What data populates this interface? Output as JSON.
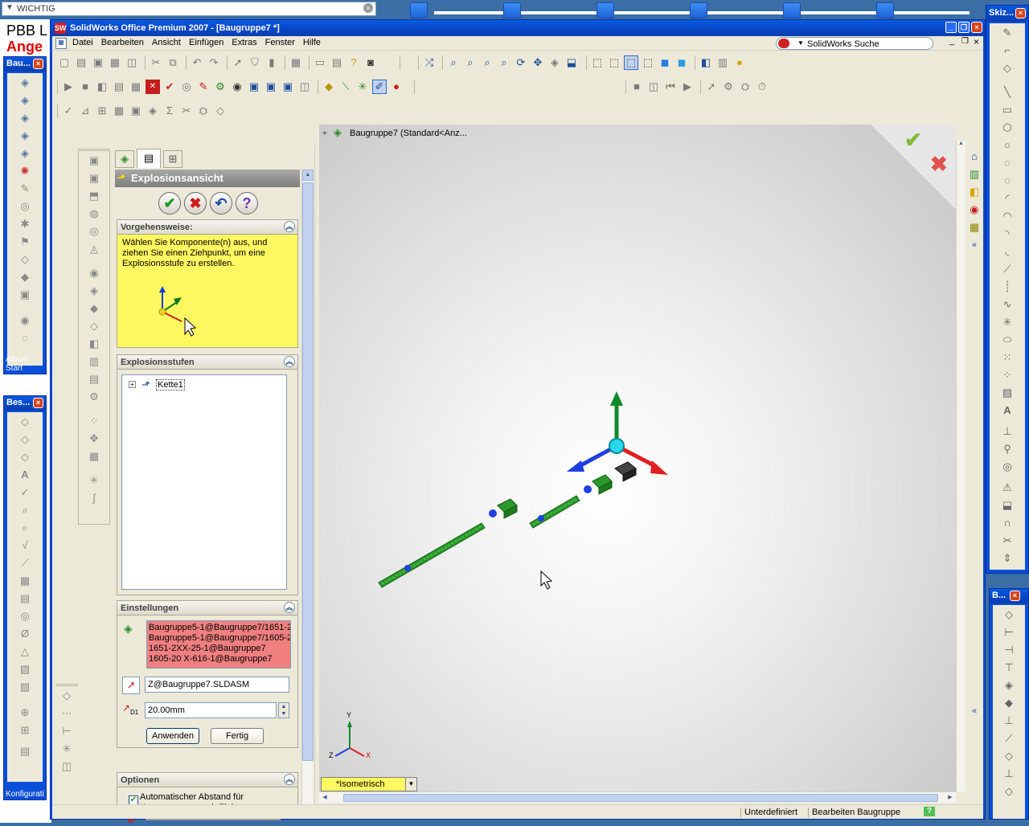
{
  "taskbar": {
    "search_label": "WICHTIG"
  },
  "background_window": {
    "text1": "PBB L",
    "text2": "Ange"
  },
  "left_palette1": {
    "title": "Bau...",
    "footer": "Album Start"
  },
  "left_palette2": {
    "title": "Bes...",
    "footer": "Konfigurati"
  },
  "right_palette1": {
    "title": "Skiz..."
  },
  "right_palette2": {
    "title": "B..."
  },
  "window": {
    "title": "SolidWorks Office Premium 2007 - [Baugruppe7 *]",
    "search_label": "SolidWorks Suche"
  },
  "menu": [
    "Datei",
    "Bearbeiten",
    "Ansicht",
    "Einfügen",
    "Extras",
    "Fenster",
    "Hilfe"
  ],
  "tree": {
    "root_label": "Baugruppe7  (Standard<Anz..."
  },
  "property_manager": {
    "title": "Explosionsansicht",
    "procedure": {
      "header": "Vorgehensweise:",
      "text": "Wählen Sie Komponente(n) aus, und ziehen Sie einen Ziehpunkt, um eine Explosionsstufe zu erstellen."
    },
    "steps": {
      "header": "Explosionsstufen",
      "items": [
        "Kette1"
      ]
    },
    "settings": {
      "header": "Einstellungen",
      "components": [
        "Baugruppe5-1@Baugruppe7/1651-2",
        "Baugruppe5-1@Baugruppe7/1605-20",
        "1651-2XX-25-1@Baugruppe7",
        "1605-20 X-616-1@Baugruppe7"
      ],
      "direction": "Z@Baugruppe7.SLDASM",
      "distance": "20.00mm",
      "apply_label": "Anwenden",
      "done_label": "Fertig"
    },
    "options": {
      "header": "Optionen",
      "auto_spacing_label": "Automatischer Abstand für Komponenten nach Ziehen",
      "auto_spacing_checked": true
    }
  },
  "viewport": {
    "view_name": "*Isometrisch",
    "triad": {
      "x": "X",
      "y": "Y",
      "z": "Z"
    }
  },
  "statusbar": {
    "state": "Unterdefiniert",
    "mode": "Bearbeiten Baugruppe",
    "help": "?"
  }
}
